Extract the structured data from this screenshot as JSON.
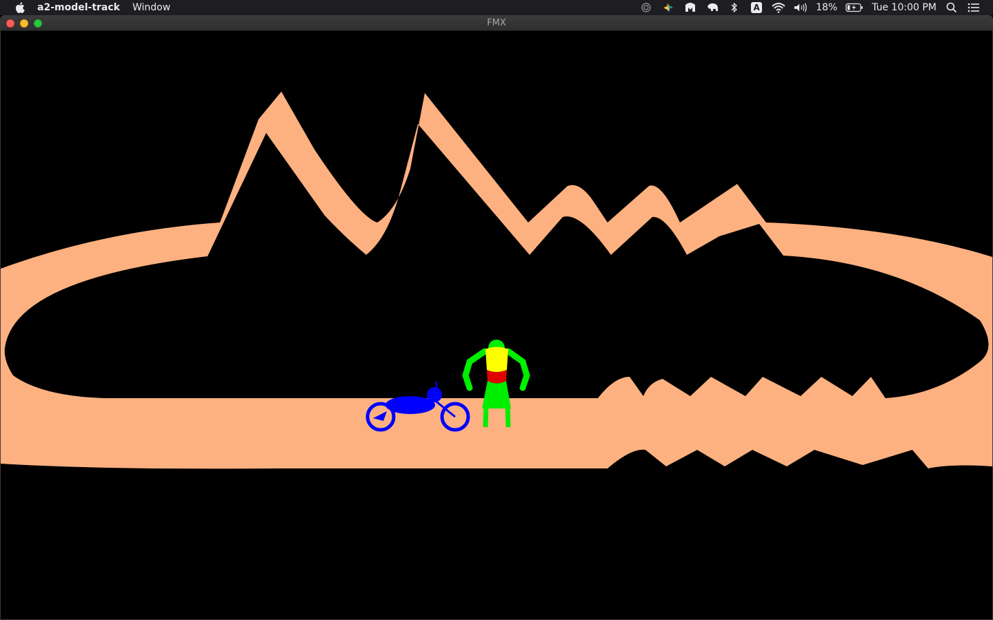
{
  "menubar": {
    "app_name": "a2-model-track",
    "menu_items": [
      "Window"
    ],
    "battery": "18%",
    "clock": "Tue 10:00 PM",
    "input_source": "A"
  },
  "window": {
    "title": "FMX"
  },
  "scene": {
    "background_color": "#000000",
    "track_color": "#feb180",
    "bike_color": "#0000ff",
    "rider_body_color": "#00ee00",
    "rider_torso_color": "#ffff00",
    "rider_belt_color": "#e00000"
  }
}
